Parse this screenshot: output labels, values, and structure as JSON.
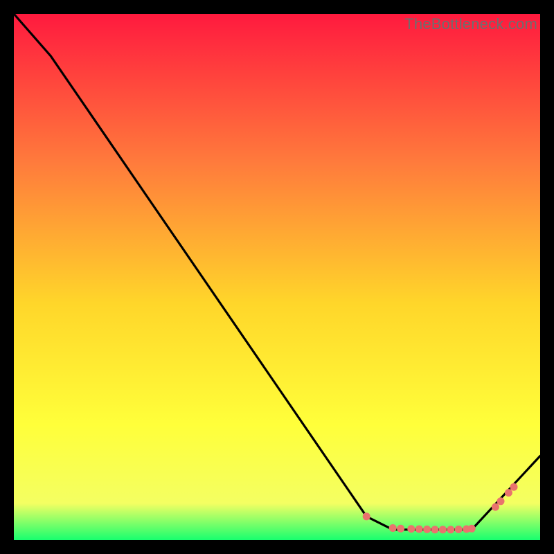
{
  "watermark": "TheBottleneck.com",
  "colors": {
    "line": "#000000",
    "dot": "#e9736d",
    "bg_top": "#ff1a3e",
    "bg_mid1": "#ff7a3c",
    "bg_mid2": "#ffd62a",
    "bg_mid3": "#ffff3a",
    "bg_mid4": "#f4ff62",
    "bg_bot": "#17ff6f"
  },
  "chart_data": {
    "type": "line",
    "title": "",
    "xlabel": "",
    "ylabel": "",
    "xlim": [
      0,
      100
    ],
    "ylim": [
      0,
      100
    ],
    "series": [
      {
        "name": "curve",
        "x": [
          0,
          7,
          67,
          72,
          87,
          100
        ],
        "y": [
          100,
          92,
          4.5,
          2,
          2,
          16
        ]
      },
      {
        "name": "dots",
        "x": [
          67,
          72,
          73.5,
          75.5,
          77,
          78.5,
          80,
          81.5,
          83,
          84.5,
          86,
          87,
          91.5,
          92.5,
          94,
          95
        ],
        "y": [
          4.5,
          2.3,
          2.2,
          2.15,
          2.1,
          2.05,
          2.0,
          2.0,
          2.0,
          2.05,
          2.1,
          2.2,
          6.3,
          7.4,
          9.0,
          10.1
        ]
      }
    ]
  }
}
